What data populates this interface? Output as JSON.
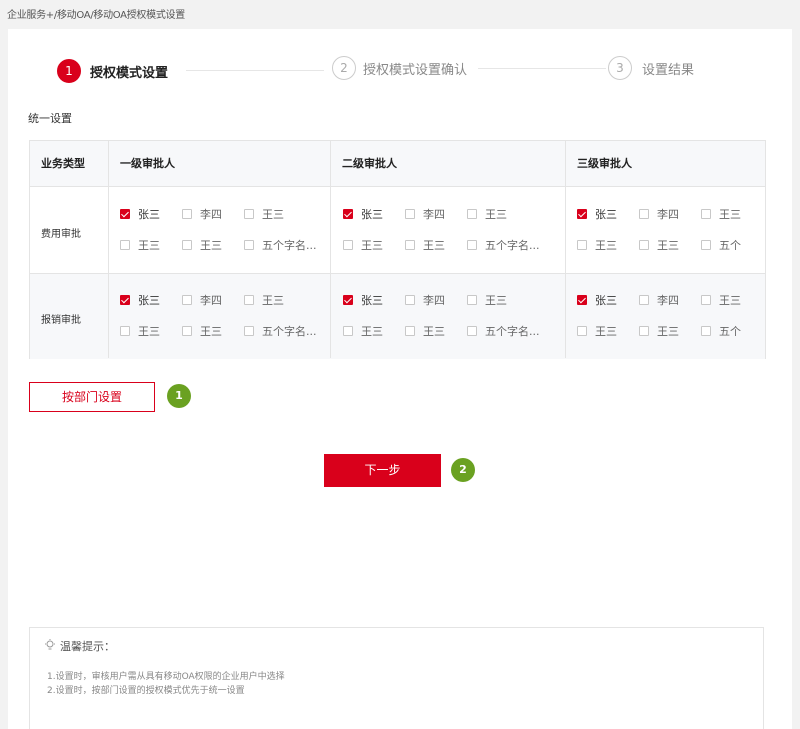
{
  "breadcrumb": {
    "item1": "企业服务+",
    "sep": "/",
    "item2": "移动OA",
    "item3": "移动OA授权模式设置"
  },
  "steps": [
    {
      "number": "1",
      "label": "授权模式设置",
      "state": "active"
    },
    {
      "number": "2",
      "label": "授权模式设置确认",
      "state": "inactive"
    },
    {
      "number": "3",
      "label": "设置结果",
      "state": "inactive"
    }
  ],
  "section_title": "统一设置",
  "table": {
    "headers": [
      "业务类型",
      "一级审批人",
      "二级审批人",
      "三级审批人"
    ],
    "rows": [
      {
        "label": "费用审批",
        "levels": [
          [
            {
              "name": "张三",
              "checked": true
            },
            {
              "name": "李四",
              "checked": false
            },
            {
              "name": "王三",
              "checked": false
            },
            {
              "name": "王三",
              "checked": false
            },
            {
              "name": "王三",
              "checked": false
            },
            {
              "name": "五个字名...",
              "checked": false
            }
          ],
          [
            {
              "name": "张三",
              "checked": true
            },
            {
              "name": "李四",
              "checked": false
            },
            {
              "name": "王三",
              "checked": false
            },
            {
              "name": "王三",
              "checked": false
            },
            {
              "name": "王三",
              "checked": false
            },
            {
              "name": "五个字名...",
              "checked": false
            }
          ],
          [
            {
              "name": "张三",
              "checked": true
            },
            {
              "name": "李四",
              "checked": false
            },
            {
              "name": "王三",
              "checked": false
            },
            {
              "name": "王三",
              "checked": false
            },
            {
              "name": "王三",
              "checked": false
            },
            {
              "name": "五个",
              "checked": false
            }
          ]
        ]
      },
      {
        "label": "报销审批",
        "levels": [
          [
            {
              "name": "张三",
              "checked": true
            },
            {
              "name": "李四",
              "checked": false
            },
            {
              "name": "王三",
              "checked": false
            },
            {
              "name": "王三",
              "checked": false
            },
            {
              "name": "王三",
              "checked": false
            },
            {
              "name": "五个字名...",
              "checked": false
            }
          ],
          [
            {
              "name": "张三",
              "checked": true
            },
            {
              "name": "李四",
              "checked": false
            },
            {
              "name": "王三",
              "checked": false
            },
            {
              "name": "王三",
              "checked": false
            },
            {
              "name": "王三",
              "checked": false
            },
            {
              "name": "五个字名...",
              "checked": false
            }
          ],
          [
            {
              "name": "张三",
              "checked": true
            },
            {
              "name": "李四",
              "checked": false
            },
            {
              "name": "王三",
              "checked": false
            },
            {
              "name": "王三",
              "checked": false
            },
            {
              "name": "王三",
              "checked": false
            },
            {
              "name": "五个",
              "checked": false
            }
          ]
        ]
      }
    ]
  },
  "buttons": {
    "by_department": "按部门设置",
    "next": "下一步"
  },
  "badges": [
    "1",
    "2"
  ],
  "tips": {
    "title": "温馨提示：",
    "lines": [
      "1.设置时，审核用户需从具有移动OA权限的企业用户中选择",
      "2.设置时，按部门设置的授权模式优先于统一设置"
    ]
  },
  "colors": {
    "accent": "#d9001b",
    "badge": "#6aa121",
    "background": "#f2f2f2"
  },
  "icons": [
    "lightbulb-icon",
    "check-icon"
  ]
}
